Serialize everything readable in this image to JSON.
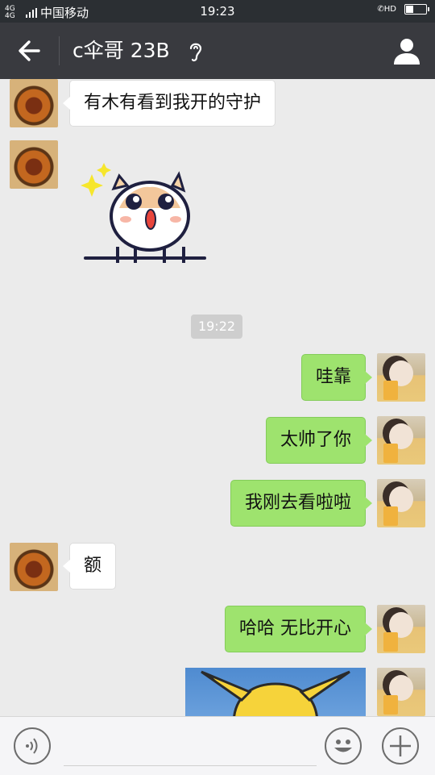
{
  "status_bar": {
    "network": "4G 4G",
    "carrier": "中国移动",
    "time": "19:23",
    "call_indicator": "HD"
  },
  "header": {
    "title": "c伞哥 23B",
    "back_icon": "arrow-left-icon",
    "mode_icon": "ear-icon",
    "profile_icon": "person-icon"
  },
  "chat": {
    "messages": [
      {
        "side": "left",
        "type": "text",
        "text": "有木有看到我开的守护"
      },
      {
        "side": "left",
        "type": "sticker",
        "sticker": "surprised-corgi"
      },
      {
        "type": "timestamp",
        "text": "19:22"
      },
      {
        "side": "right",
        "type": "text",
        "text": "哇靠"
      },
      {
        "side": "right",
        "type": "text",
        "text": "太帅了你"
      },
      {
        "side": "right",
        "type": "text",
        "text": "我刚去看啦啦"
      },
      {
        "side": "left",
        "type": "text",
        "text": "额"
      },
      {
        "side": "right",
        "type": "text",
        "text": "哈哈 无比开心"
      },
      {
        "side": "right",
        "type": "image",
        "image": "pikachu-picture"
      }
    ]
  },
  "input_bar": {
    "voice_icon": "voice-icon",
    "emoji_icon": "emoji-icon",
    "plus_icon": "plus-icon",
    "placeholder": ""
  },
  "colors": {
    "header_bg": "#393a3f",
    "chat_bg": "#ebebeb",
    "outgoing_bubble": "#9ee36e",
    "incoming_bubble": "#ffffff"
  }
}
